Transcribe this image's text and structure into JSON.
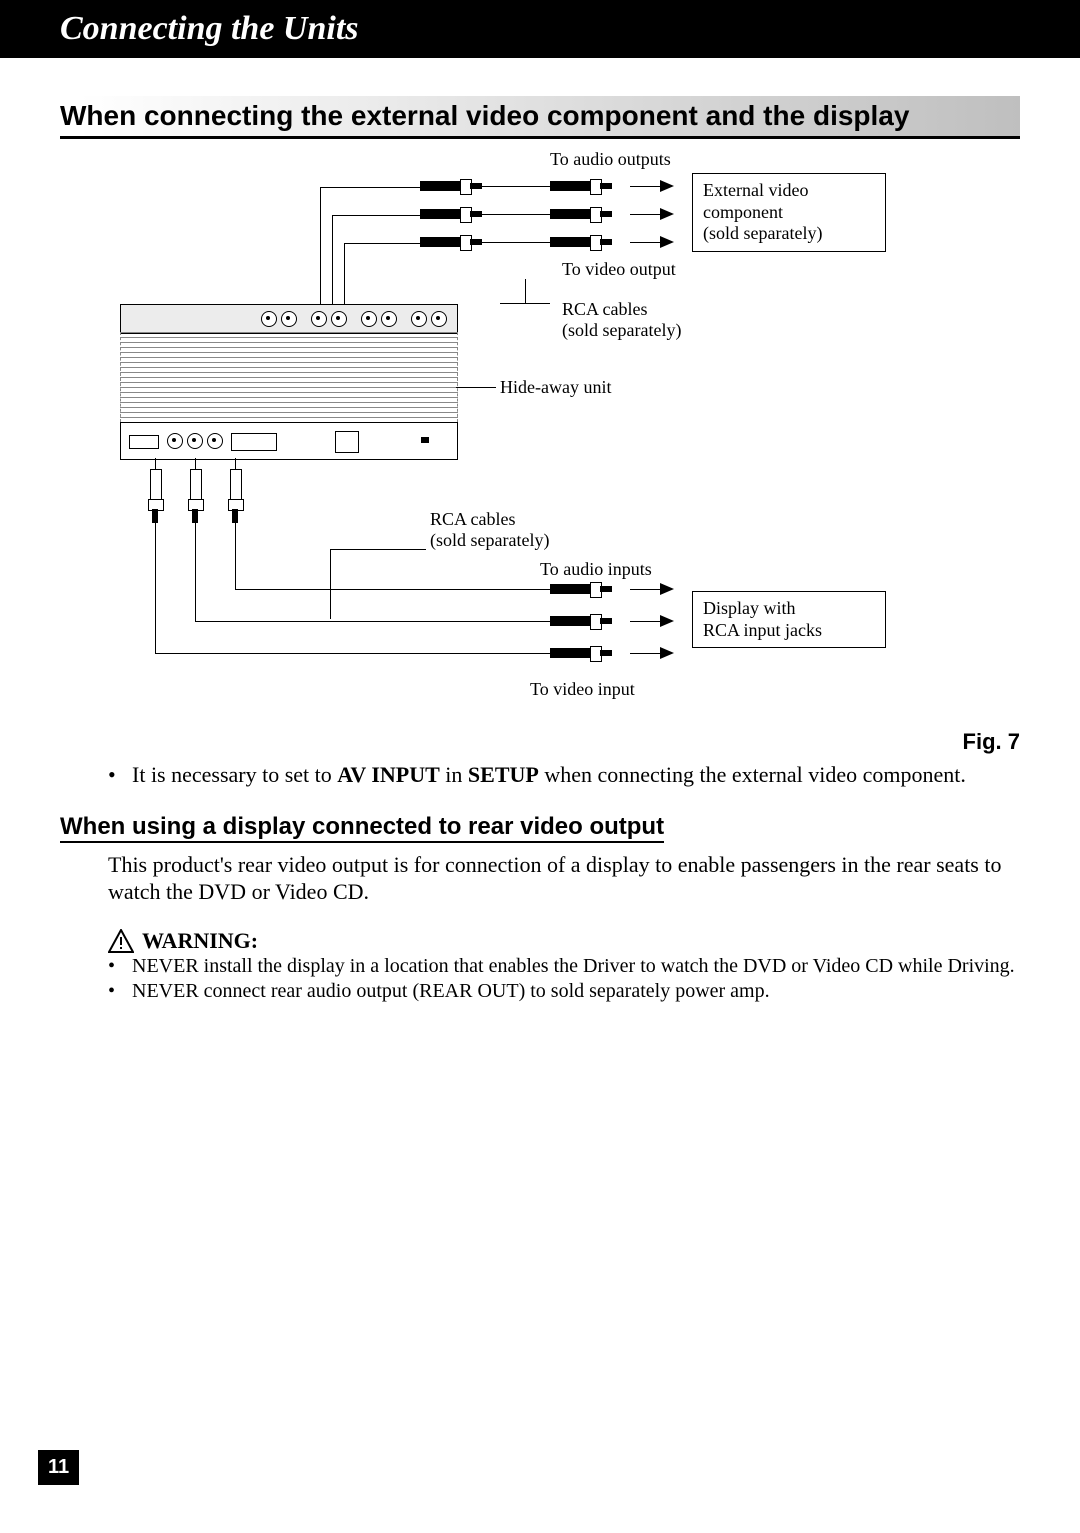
{
  "banner_title": "Connecting the Units",
  "section1_title": "When connecting the external video component and the display",
  "figure_caption": "Fig. 7",
  "bullet1_prefix": "It is necessary to set to ",
  "bullet1_bold1": "AV INPUT",
  "bullet1_mid": " in ",
  "bullet1_bold2": "SETUP",
  "bullet1_suffix": " when connecting the external video com­ponent.",
  "section2_title": "When using a display connected to rear video output",
  "section2_body": "This product's rear video output is for connection of a display to enable passengers in the rear seats to watch the DVD or Video CD.",
  "warning_label": "WARNING:",
  "warning_bullet1": "NEVER install the display in a location that enables the Driver to watch the DVD or Video CD while Driving.",
  "warning_bullet2": "NEVER connect rear audio output (REAR OUT) to sold separately power amp.",
  "page_number": "11",
  "diagram": {
    "to_audio_outputs": "To audio outputs",
    "to_video_output": "To video output",
    "rca_cables": "RCA cables",
    "sold_separately": "(sold separately)",
    "hide_away_unit": "Hide-away unit",
    "to_audio_inputs": "To audio inputs",
    "to_video_input": "To video input",
    "external_video_component": "External video",
    "component_word": "component",
    "display_with": "Display with",
    "rca_input_jacks": "RCA input jacks"
  }
}
